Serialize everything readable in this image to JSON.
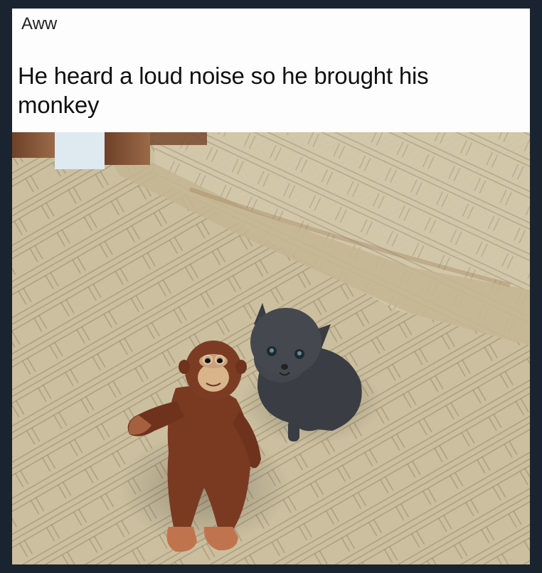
{
  "post": {
    "tag": "Aww",
    "headline": "He heard a loud noise so he brought his monkey"
  },
  "photo": {
    "subject": "kitten-and-stuffed-monkey",
    "colors": {
      "carpet": "#cfc3a5",
      "carpet_lines": "#8c7f66",
      "wood": "#8a5a3a",
      "monkey_fur": "#7a3a22",
      "kitten_fur": "#3f4148",
      "frame": "#1a2430"
    }
  }
}
